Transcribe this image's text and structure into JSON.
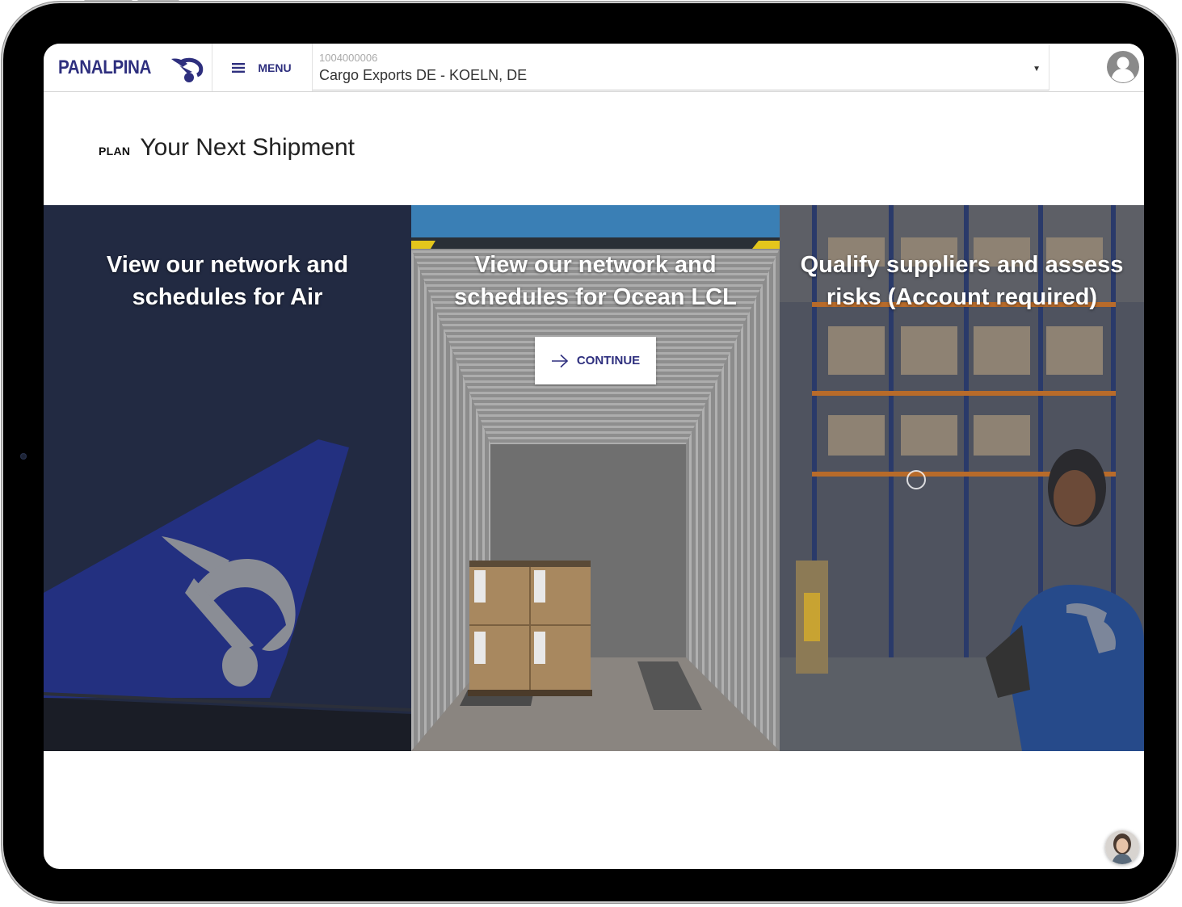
{
  "header": {
    "logo_text": "PANALPINA",
    "menu_label": "MENU",
    "account_selector": {
      "account_id": "1004000006",
      "account_name": "Cargo Exports DE - KOELN, DE"
    }
  },
  "page": {
    "plan_label": "PLAN",
    "title": "Your Next Shipment"
  },
  "panels": {
    "air": {
      "heading_line1": "View our network and",
      "heading_line2": "schedules for Air"
    },
    "ocean": {
      "heading_line1": "View our network and",
      "heading_line2": "schedules for Ocean LCL",
      "cta_label": "CONTINUE"
    },
    "supplier": {
      "heading_line1": "Qualify suppliers and assess",
      "heading_line2": "risks (Account required)"
    }
  },
  "colors": {
    "brand": "#2e2f7e",
    "air_panel_bg": "#222a42"
  },
  "icons": {
    "menu": "hamburger-icon",
    "dropdown": "caret-down-icon",
    "user": "user-avatar-icon",
    "continue": "arrow-right-icon",
    "chat": "chat-agent-avatar"
  }
}
